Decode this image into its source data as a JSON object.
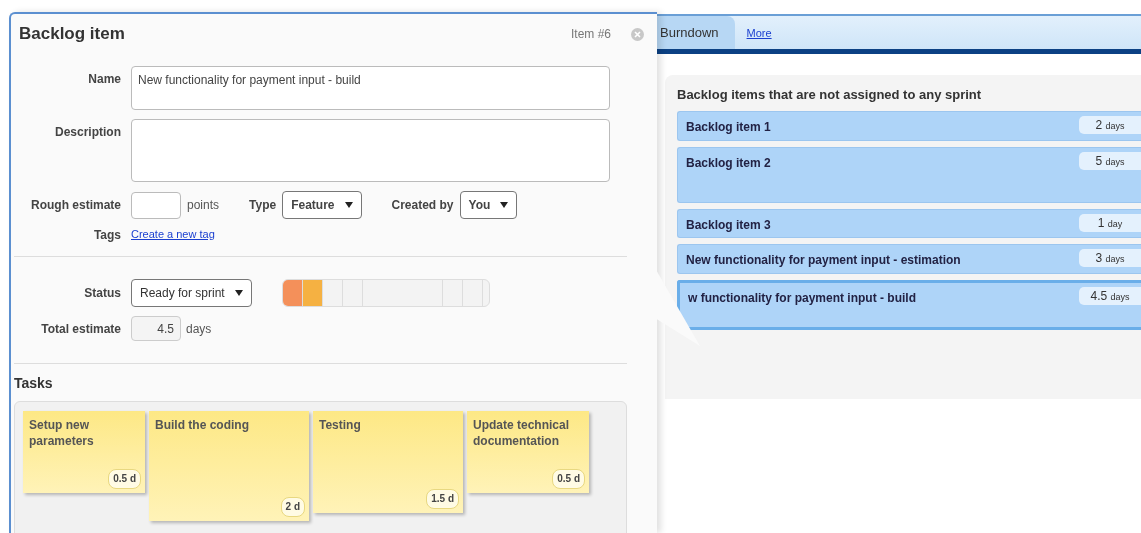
{
  "dialog": {
    "title": "Backlog item",
    "item_number": "Item #6",
    "name": {
      "label": "Name",
      "value": "New functionality for payment input - build"
    },
    "description": {
      "label": "Description"
    },
    "rough_estimate": {
      "label": "Rough estimate",
      "unit": "points"
    },
    "type": {
      "label": "Type",
      "value": "Feature"
    },
    "created_by": {
      "label": "Created by",
      "value": "You"
    },
    "tags": {
      "label": "Tags",
      "link": "Create a new tag"
    },
    "status": {
      "label": "Status",
      "value": "Ready for sprint"
    },
    "status_segments": [
      {
        "filled": true,
        "color": "#f4905a"
      },
      {
        "filled": true,
        "color": "#f5b142"
      },
      {
        "filled": false
      },
      {
        "filled": false
      },
      {
        "filled": false
      },
      {
        "filled": false
      },
      {
        "filled": false
      }
    ],
    "total_estimate": {
      "label": "Total estimate",
      "value": "4.5",
      "unit": "days"
    },
    "tasks_title": "Tasks",
    "tasks": [
      {
        "title": "Setup new parameters",
        "estimate": "0.5 d"
      },
      {
        "title": "Build the coding",
        "estimate": "2 d"
      },
      {
        "title": "Testing",
        "estimate": "1.5 d"
      },
      {
        "title": "Update technical documentation",
        "estimate": "0.5 d"
      }
    ]
  },
  "tabs": [
    {
      "label": "Burndown",
      "selected": true
    },
    {
      "label": "More",
      "selected": false
    }
  ],
  "backlog": {
    "title": "Backlog items that are not assigned to any sprint",
    "items": [
      {
        "name": "Backlog item 1",
        "estimate": "2",
        "unit": "days",
        "selected": false
      },
      {
        "name": "Backlog item 2",
        "estimate": "5",
        "unit": "days",
        "selected": false
      },
      {
        "name": "Backlog item 3",
        "estimate": "1",
        "unit": "day",
        "selected": false
      },
      {
        "name": "New functionality for payment input - estimation",
        "estimate": "3",
        "unit": "days",
        "selected": false
      },
      {
        "name": "w functionality for payment input - build",
        "estimate": "4.5",
        "unit": "days",
        "selected": true
      }
    ]
  }
}
